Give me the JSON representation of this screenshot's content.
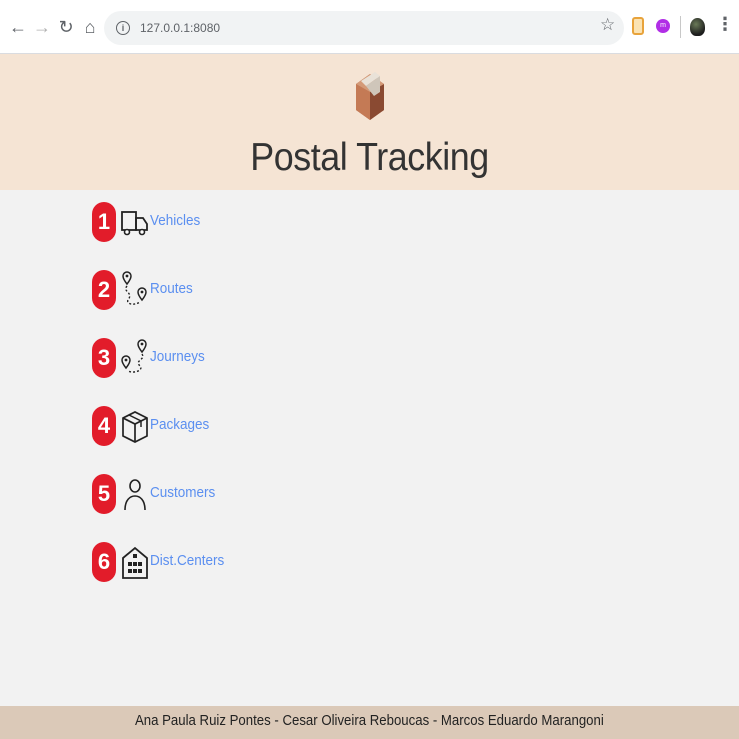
{
  "browser": {
    "url": "127.0.0.1:8080",
    "ext_label": "m"
  },
  "header": {
    "title": "Postal Tracking"
  },
  "menu": {
    "items": [
      {
        "number": "1",
        "label": "Vehicles",
        "icon": "truck-icon"
      },
      {
        "number": "2",
        "label": "Routes",
        "icon": "route-pins-icon"
      },
      {
        "number": "3",
        "label": "Journeys",
        "icon": "journey-pins-icon"
      },
      {
        "number": "4",
        "label": "Packages",
        "icon": "package-box-icon"
      },
      {
        "number": "5",
        "label": "Customers",
        "icon": "person-icon"
      },
      {
        "number": "6",
        "label": "Dist.Centers",
        "icon": "building-icon"
      }
    ]
  },
  "footer": {
    "text": "Ana Paula Ruiz Pontes - Cesar Oliveira Reboucas - Marcos Eduardo Marangoni"
  },
  "colors": {
    "header_bg": "#f5e4d4",
    "footer_bg": "#dbc9b8",
    "badge": "#e21c2a",
    "link": "#5b8ff0"
  }
}
